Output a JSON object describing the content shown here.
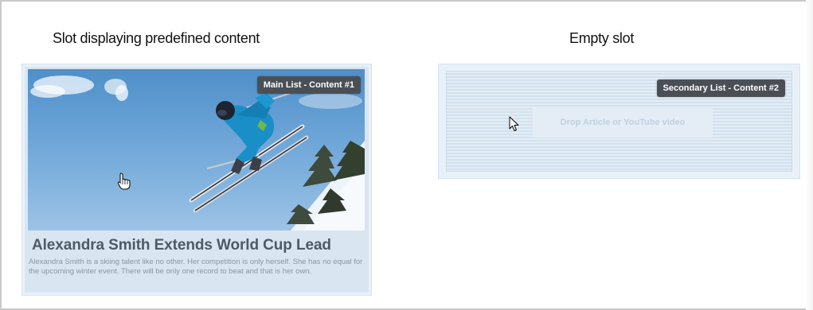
{
  "captions": {
    "left": "Slot displaying predefined content",
    "right": "Empty slot"
  },
  "main_slot": {
    "badge": "Main List - Content #1",
    "article_title": "Alexandra Smith Extends World Cup Lead",
    "article_body": "Alexandra Smith is a skiing talent like no other. Her competition is only herself. She has no equal for the upcoming winter event. There will be only one record to beat and that is her own."
  },
  "secondary_slot": {
    "badge": "Secondary List - Content #2",
    "drop_placeholder": "Drop Article or YouTube video"
  },
  "cursors": {
    "main": "hand-pointer-icon",
    "secondary": "arrow-pointer-icon"
  },
  "colors": {
    "badge_bg": "#4a4f56",
    "slot_bg": "#d9e6f2",
    "title_text": "#4f5a64"
  }
}
